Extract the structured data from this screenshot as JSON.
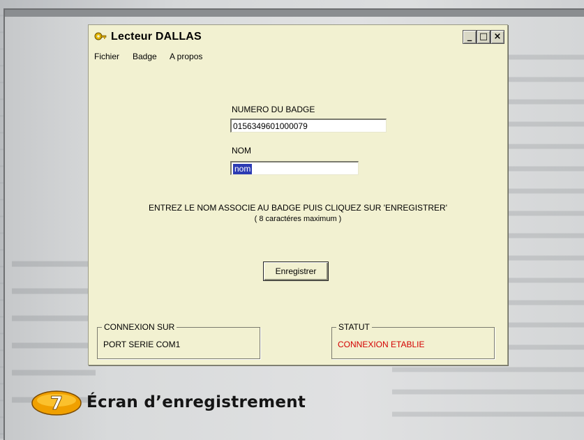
{
  "window": {
    "title": "Lecteur DALLAS",
    "controls": {
      "minimize": "_",
      "maximize": "□",
      "close": "×"
    }
  },
  "menubar": {
    "items": [
      {
        "label": "Fichier"
      },
      {
        "label": "Badge"
      },
      {
        "label": "A propos"
      }
    ]
  },
  "form": {
    "badge_label": "NUMERO DU BADGE",
    "badge_value": "0156349601000079",
    "name_label": "NOM",
    "name_value": "nom"
  },
  "instructions": {
    "main": "ENTREZ LE NOM ASSOCIE AU BADGE PUIS CLIQUEZ SUR 'ENREGISTRER'",
    "sub": "( 8 caractéres maximum )"
  },
  "actions": {
    "save_label": "Enregistrer"
  },
  "connection": {
    "title": "CONNEXION SUR",
    "value": "PORT SERIE COM1"
  },
  "status": {
    "title": "STATUT",
    "value": "CONNEXION ETABLIE",
    "value_color": "#d40000"
  },
  "caption": {
    "number": "7",
    "text": "Écran d’enregistrement",
    "badge_color": "#f0a000"
  },
  "colors": {
    "window_bg": "#f2f1d1",
    "selection": "#2c3bb3"
  }
}
